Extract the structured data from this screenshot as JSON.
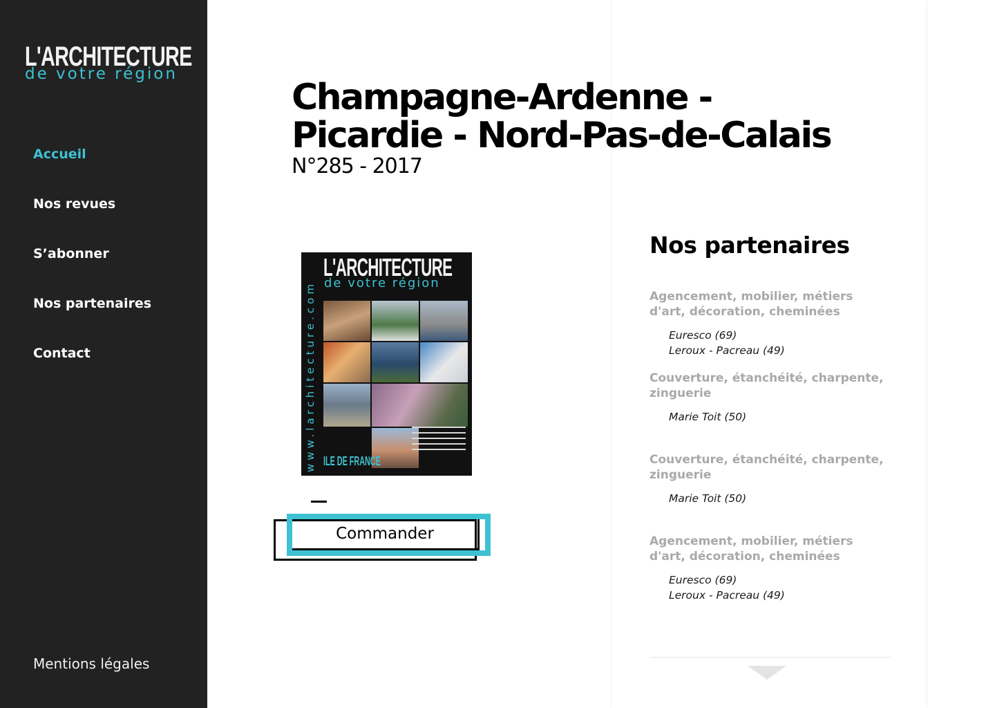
{
  "brand": {
    "logo_top": "L'ARCHITECTURE",
    "logo_bottom": "de votre région"
  },
  "nav": {
    "items": [
      {
        "label": "Accueil",
        "active": true
      },
      {
        "label": "Nos revues",
        "active": false
      },
      {
        "label": "S’abonner",
        "active": false
      },
      {
        "label": "Nos partenaires",
        "active": false
      },
      {
        "label": "Contact",
        "active": false
      }
    ],
    "legal_label": "Mentions légales"
  },
  "issue": {
    "title_line1": "Champagne-Ardenne -",
    "title_line2": "Picardie - Nord-Pas-de-Calais",
    "number": "N°285 - 2017",
    "order_label": "Commander"
  },
  "cover": {
    "title": "L'ARCHITECTURE",
    "subtitle": "de votre région",
    "vertical_url": "www.larchitecture.com",
    "region": "ILE DE FRANCE"
  },
  "partners": {
    "title": "Nos partenaires",
    "categories": [
      {
        "name": "Agencement, mobilier, métiers d'art, décoration, cheminées",
        "items": [
          "Euresco (69)",
          "Leroux - Pacreau (49)"
        ]
      },
      {
        "name": "Couverture, étanchéité, charpente, zinguerie",
        "items": [
          "Marie Toit (50)"
        ]
      },
      {
        "name": "Couverture, étanchéité, charpente, zinguerie",
        "items": [
          "Marie Toit (50)"
        ]
      },
      {
        "name": "Agencement, mobilier, métiers d'art, décoration, cheminées",
        "items": [
          "Euresco (69)",
          "Leroux - Pacreau (49)"
        ]
      }
    ]
  },
  "colors": {
    "sidebar_bg": "#222222",
    "accent": "#3ec1d3",
    "category_gray": "#a9a9a9"
  },
  "icons": {
    "scroll": "triangle-down-icon"
  }
}
